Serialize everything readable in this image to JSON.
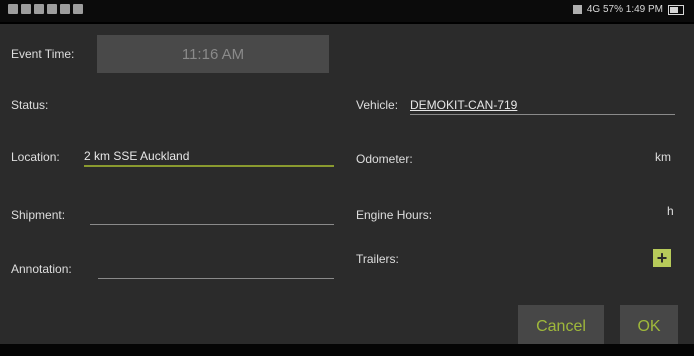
{
  "status_bar": {
    "right_text": "4G  57%  1:49 PM"
  },
  "form": {
    "event_time_label": "Event Time:",
    "event_time_value": "11:16 AM",
    "status_label": "Status:",
    "vehicle_label": "Vehicle:",
    "vehicle_value": "DEMOKIT-CAN-719",
    "location_label": "Location:",
    "location_value": "2 km SSE Auckland",
    "odometer_label": "Odometer:",
    "odometer_unit": "km",
    "shipment_label": "Shipment:",
    "shipment_value": "",
    "engine_hours_label": "Engine Hours:",
    "engine_hours_unit": "h",
    "annotation_label": "Annotation:",
    "annotation_value": "",
    "trailers_label": "Trailers:",
    "add_trailer": "+"
  },
  "buttons": {
    "cancel": "Cancel",
    "ok": "OK"
  },
  "colors": {
    "accent": "#9fb83b",
    "panel_bg": "#2b2b2b",
    "button_bg": "#474747"
  }
}
